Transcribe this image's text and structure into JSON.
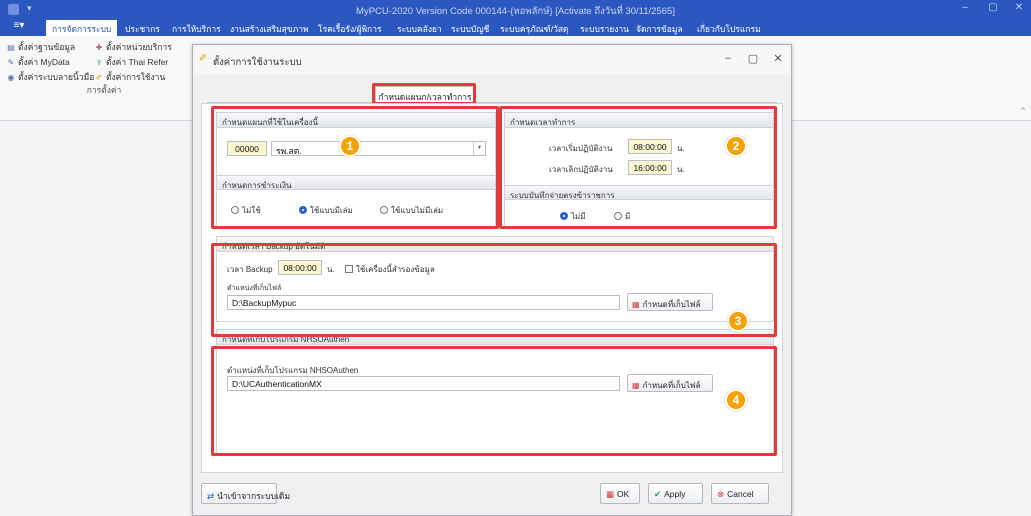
{
  "titlebar": {
    "title": "MyPCU-2020 Version Code 000144-{หอพลักษ์} [Activate ถึงวันที่ 30/11/2565]",
    "quick_access": "▾",
    "min": "–",
    "max": "▢",
    "close": "✕"
  },
  "menubar": {
    "file_icon": "≡▾",
    "tabs": [
      "การจัดการระบบ",
      "ประชากร",
      "การให้บริการ",
      "งานสร้างเสริมสุขภาพ",
      "โรคเรื้อรัง/ผู้พิการ",
      "ระบบคลังยา",
      "ระบบบัญชี",
      "ระบบครุภัณฑ์/วัสดุ",
      "ระบบรายงาน",
      "จัดการข้อมูล",
      "เกี่ยวกับโปรแกรม"
    ]
  },
  "ribbon": {
    "items": [
      "ตั้งค่าฐานข้อมูล",
      "ตั้งค่าหน่วยบริการ",
      "ตั้งค่า MyData",
      "ตั้งค่า Thai Refer",
      "ตั้งค่าระบบลายนิ้วมือ",
      "ตั้งค่าการใช้งาน"
    ],
    "group_label": "การตั้งค่า",
    "collapse_icon": "⌃"
  },
  "dialog": {
    "title": "ตั้งค่าการใช้งานระบบ",
    "min": "–",
    "max": "▢",
    "close": "✕",
    "active_tab": "กำหนดแผนก/เวลาทำการ",
    "panel1": {
      "header": "กำหนดแผนกที่ใช้ในเครื่องนี้",
      "dept_code": "00000",
      "dept_name": "รพ.สต.",
      "dropdown_caret": "▾",
      "sub_header": "กำหนดการชำระเงิน",
      "radios": [
        "ไม่ใช้",
        "ใช้แบบมีเล่ม",
        "ใช้แบบไม่มีเล่ม"
      ],
      "selected_radio": 1
    },
    "panel2": {
      "header": "กำหนดเวลาทำการ",
      "start_label": "เวลาเริ่มปฏิบัติงาน",
      "start_time": "08:00:00",
      "end_label": "เวลาเลิกปฏิบัติงาน",
      "end_time": "16:00:00",
      "unit": "น.",
      "sub_header": "ระบบบันทึกจ่ายตรงข้าราชการ",
      "radios": [
        "ไม่มี",
        "มี"
      ],
      "selected_radio": 0
    },
    "panel3": {
      "header": "กำหนดเวลา Backup อัตโนมัติ",
      "time_label": "เวลา Backup",
      "time_value": "08:00:00",
      "unit": "น.",
      "checkbox_label": "ใช้เครื่องนี้สำรองข้อมูล",
      "path_label": "ตำแหน่งที่เก็บไฟล์",
      "path_value": "D:\\BackupMypuc",
      "browse_label": "กำหนดที่เก็บไฟล์"
    },
    "panel4": {
      "header": "กำหนดที่เก็บโปรแกรม NHSOAuthen",
      "path_label": "ตำแหน่งที่เก็บโปรแกรม NHSOAuthen",
      "path_value": "D:\\UCAuthenticationMX",
      "browse_label": "กำหนดที่เก็บไฟล์"
    },
    "badges": [
      "1",
      "2",
      "3",
      "4"
    ],
    "footer": {
      "import_label": "นำเข้าจากระบบเดิม",
      "ok_label": "OK",
      "apply_label": "Apply",
      "cancel_label": "Cancel"
    }
  },
  "colors": {
    "titlebar": "#2b57c0",
    "highlight": "#e33b3b",
    "badge": "#f5a300",
    "time_field": "#fbf7d2"
  }
}
